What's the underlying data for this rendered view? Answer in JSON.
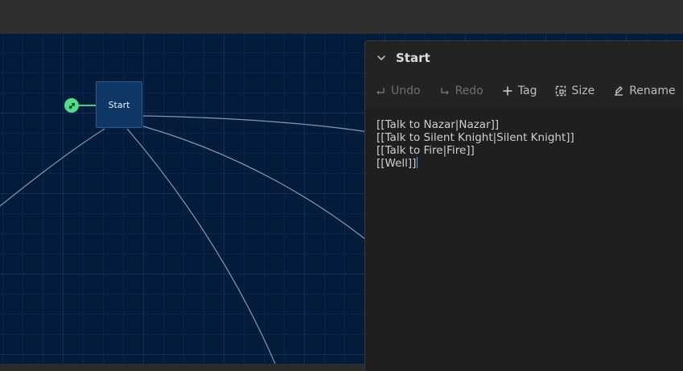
{
  "passage": {
    "name": "Start",
    "badge_icon": "rocket-icon"
  },
  "dialog": {
    "title": "Start",
    "toolbar": {
      "undo": "Undo",
      "redo": "Redo",
      "tag": "Tag",
      "size": "Size",
      "rename": "Rename"
    },
    "text_lines": [
      "[[Talk to Nazar|Nazar]]",
      "[[Talk to Silent Knight|Silent Knight]]",
      "[[Talk to Fire|Fire]]",
      "[[Well]]"
    ]
  },
  "colors": {
    "canvas_bg": "#041b3b",
    "node_bg": "#0f3765",
    "start_badge": "#4de08a",
    "panel_bg": "#232323",
    "cursor": "#4a90ff"
  }
}
